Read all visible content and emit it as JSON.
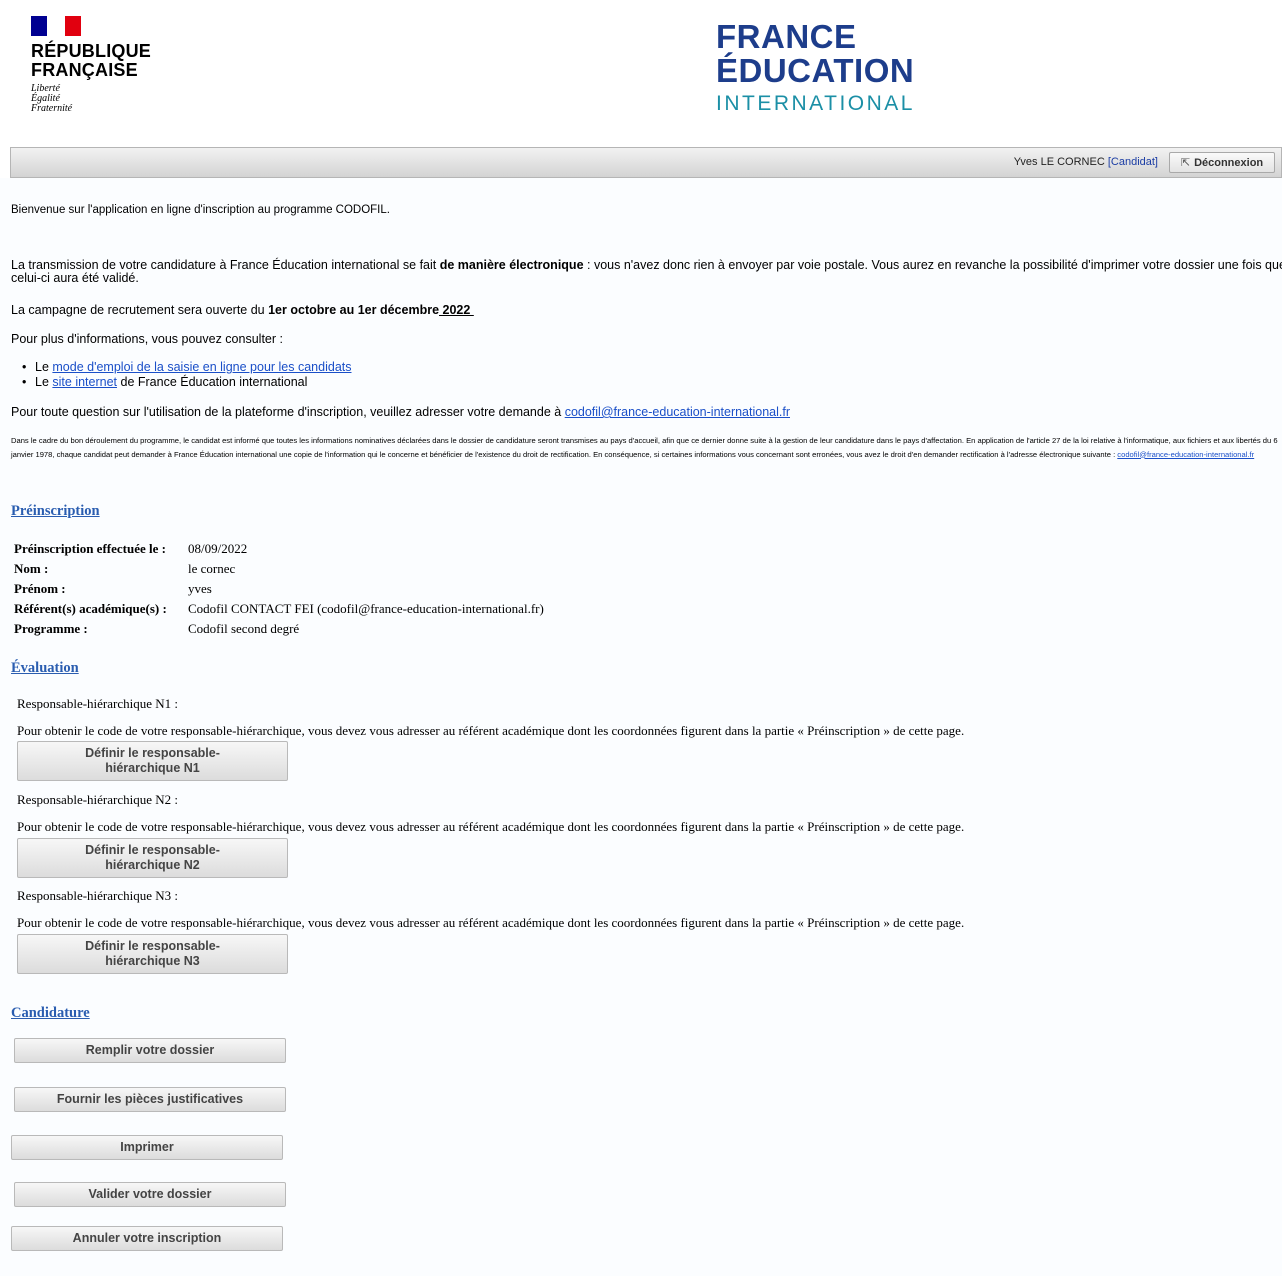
{
  "header": {
    "rf": {
      "name_line1": "RÉPUBLIQUE",
      "name_line2": "FRANÇAISE",
      "motto": [
        "Liberté",
        "Égalité",
        "Fraternité"
      ],
      "flag_colors": [
        "#000091",
        "#ffffff",
        "#e1000f"
      ]
    },
    "fei": {
      "line1": "FRANCE",
      "line2": "ÉDUCATION",
      "line3": "INTERNATIONAL"
    }
  },
  "topbar": {
    "user_name": "Yves LE CORNEC",
    "role": "[Candidat]",
    "logout_label": "Déconnexion",
    "logout_icon": "external-link-icon"
  },
  "intro": {
    "welcome": "Bienvenue sur l'application en ligne d'inscription au programme CODOFIL.",
    "transmission_pre": "La transmission de votre candidature à France Éducation international se fait ",
    "transmission_bold": "de manière électronique",
    "transmission_post": " : vous n'avez donc rien à envoyer par voie postale. Vous aurez en revanche la possibilité d'imprimer votre dossier une fois que celui-ci aura été validé.",
    "campaign_pre": "La campagne de recrutement sera ouverte du ",
    "campaign_bold": "1er octobre au 1er décembre",
    "campaign_year": " 2022 ",
    "more_info": "Pour plus d'informations, vous pouvez consulter :",
    "bullet1_pre": "Le ",
    "bullet1_link": "mode d'emploi de la saisie en ligne pour les candidats",
    "bullet2_pre": "Le ",
    "bullet2_link": "site internet",
    "bullet2_post": " de France Éducation international",
    "question_pre": "Pour toute question sur l'utilisation de la plateforme d'inscription, veuillez adresser votre demande à ",
    "question_email": "codofil@france-education-international.fr",
    "legal_text": "Dans le cadre du bon déroulement du programme, le candidat est informé que toutes les informations nominatives déclarées dans le dossier de candidature seront transmises au pays d'accueil, afin que ce dernier donne suite à la gestion de leur candidature dans le pays d'affectation. En application de l'article 27 de la loi relative à l'informatique, aux fichiers et aux libertés du 6 janvier 1978, chaque candidat peut demander à France Éducation international une copie de l'information qui le concerne et bénéficier de l'existence du droit de rectification. En conséquence, si certaines informations vous concernant sont erronées, vous avez le droit d'en demander rectification à l'adresse électronique suivante : ",
    "legal_email": "codofil@france-education-international.fr"
  },
  "preinscription": {
    "title": "Préinscription",
    "rows": [
      {
        "label": "Préinscription effectuée le :",
        "value": "08/09/2022"
      },
      {
        "label": "Nom :",
        "value": "le cornec"
      },
      {
        "label": "Prénom :",
        "value": "yves"
      },
      {
        "label": "Référent(s) académique(s) :",
        "value": "Codofil CONTACT FEI (codofil@france-education-international.fr)"
      },
      {
        "label": "Programme :",
        "value": "Codofil second degré"
      }
    ]
  },
  "evaluation": {
    "title": "Évaluation",
    "info_text": "Pour obtenir le code de votre responsable-hiérarchique, vous devez vous adresser au référent académique dont les coordonnées figurent dans la partie « Préinscription » de cette page.",
    "items": [
      {
        "label": "Responsable-hiérarchique N1 :",
        "button": "Définir le responsable-hiérarchique N1"
      },
      {
        "label": "Responsable-hiérarchique N2 :",
        "button": "Définir le responsable-hiérarchique N2"
      },
      {
        "label": "Responsable-hiérarchique N3 :",
        "button": "Définir le responsable-hiérarchique N3"
      }
    ]
  },
  "candidature": {
    "title": "Candidature",
    "buttons": {
      "fill": "Remplir votre dossier",
      "documents": "Fournir les pièces justificatives",
      "print": "Imprimer",
      "validate": "Valider votre dossier",
      "cancel": "Annuler votre inscription"
    }
  }
}
